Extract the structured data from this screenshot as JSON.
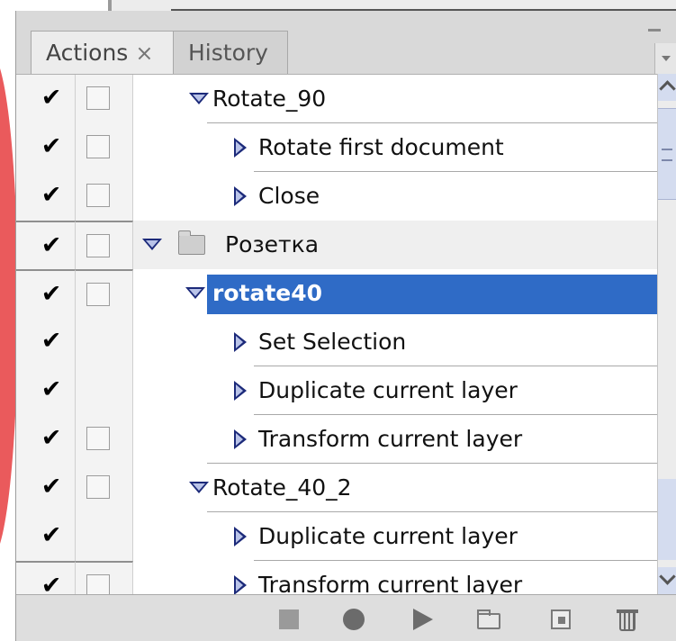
{
  "tabs": {
    "actions": "Actions",
    "actions_close": "×",
    "history": "History"
  },
  "colors": {
    "selection": "#2f6bc6",
    "triangle": "#1c2a7a"
  },
  "rows": [
    {
      "label": "Rotate_90",
      "kind": "action",
      "checked": "✔",
      "dialog_box": true
    },
    {
      "label": "Rotate first document",
      "kind": "command",
      "checked": "✔",
      "dialog_box": true
    },
    {
      "label": "Close",
      "kind": "command",
      "checked": "✔",
      "dialog_box": true
    },
    {
      "label": "Розетка",
      "kind": "set",
      "checked": "✔",
      "dialog_box": true
    },
    {
      "label": "rotate40",
      "kind": "action",
      "checked": "✔",
      "dialog_box": true,
      "selected": true
    },
    {
      "label": "Set Selection",
      "kind": "command",
      "checked": "✔",
      "dialog_box": false
    },
    {
      "label": "Duplicate current layer",
      "kind": "command",
      "checked": "✔",
      "dialog_box": false
    },
    {
      "label": "Transform current layer",
      "kind": "command",
      "checked": "✔",
      "dialog_box": true
    },
    {
      "label": "Rotate_40_2",
      "kind": "action",
      "checked": "✔",
      "dialog_box": true
    },
    {
      "label": "Duplicate current layer",
      "kind": "command",
      "checked": "✔",
      "dialog_box": false
    },
    {
      "label": "Transform current layer",
      "kind": "command",
      "checked": "✔",
      "dialog_box": true
    }
  ],
  "bottom_buttons": [
    "stop-icon",
    "record-icon",
    "play-icon",
    "new-set-icon",
    "new-action-icon",
    "trash-icon"
  ]
}
